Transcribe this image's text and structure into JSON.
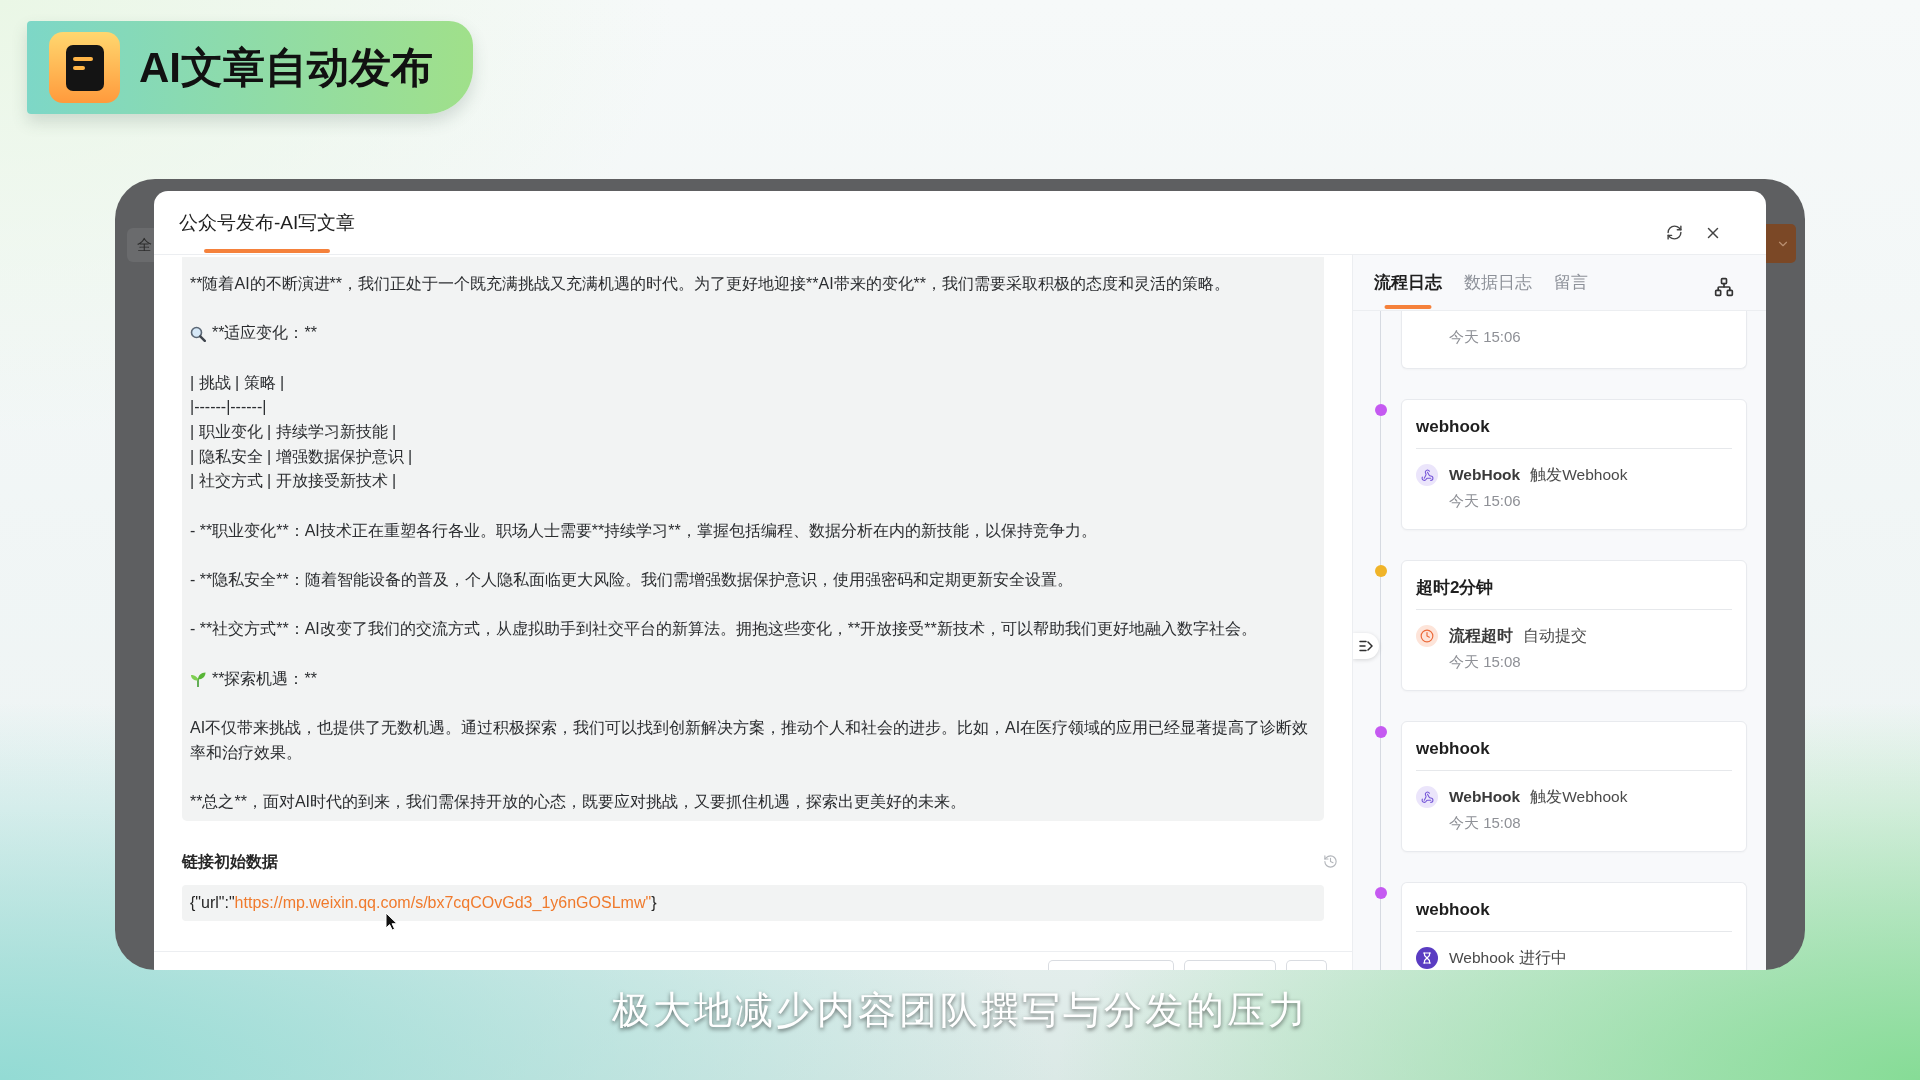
{
  "badge": {
    "title": "AI文章自动发布"
  },
  "backdrop": {
    "select_text": "全"
  },
  "modal": {
    "title": "公众号发布-AI写文章",
    "article": [
      {
        "kind": "text",
        "lines": [
          "**随着AI的不断演进**，我们正处于一个既充满挑战又充满机遇的时代。为了更好地迎接**AI带来的变化**，我们需要采取积极的态度和灵活的策略。"
        ]
      },
      {
        "kind": "search",
        "lines": [
          "**适应变化：**"
        ]
      },
      {
        "kind": "text",
        "lines": [
          "| 挑战 | 策略 |",
          "|------|------|",
          "| 职业变化 | 持续学习新技能 |",
          "| 隐私安全 | 增强数据保护意识 |",
          "| 社交方式 | 开放接受新技术 |"
        ]
      },
      {
        "kind": "text",
        "lines": [
          "- **职业变化**：AI技术正在重塑各行各业。职场人士需要**持续学习**，掌握包括编程、数据分析在内的新技能，以保持竞争力。"
        ]
      },
      {
        "kind": "text",
        "lines": [
          "- **隐私安全**：随着智能设备的普及，个人隐私面临更大风险。我们需增强数据保护意识，使用强密码和定期更新安全设置。"
        ]
      },
      {
        "kind": "text",
        "lines": [
          "- **社交方式**：AI改变了我们的交流方式，从虚拟助手到社交平台的新算法。拥抱这些变化，**开放接受**新技术，可以帮助我们更好地融入数字社会。"
        ]
      },
      {
        "kind": "sprout",
        "lines": [
          "**探索机遇：**"
        ]
      },
      {
        "kind": "text",
        "lines": [
          "AI不仅带来挑战，也提供了无数机遇。通过积极探索，我们可以找到创新解决方案，推动个人和社会的进步。比如，AI在医疗领域的应用已经显著提高了诊断效率和治疗效果。"
        ]
      },
      {
        "kind": "text",
        "lines": [
          "**总之**，面对AI时代的到来，我们需保持开放的心态，既要应对挑战，又要抓住机遇，探索出更美好的未来。"
        ]
      }
    ],
    "link_data": {
      "label": "链接初始数据",
      "prefix": "{\"url\":\"",
      "url": "https://mp.weixin.qq.com/s/bx7cqCOvGd3_1y6nGOSLmw\"",
      "suffix": "}"
    }
  },
  "side_panel": {
    "tabs": [
      {
        "label": "流程日志",
        "selected": true
      },
      {
        "label": "数据日志",
        "selected": false
      },
      {
        "label": "留言",
        "selected": false
      }
    ],
    "timeline": [
      {
        "time": "今天 15:06"
      },
      {
        "kind": "webhook",
        "color": "#c55af1",
        "title": "webhook",
        "actor": "WebHook",
        "action": "触发Webhook",
        "time": "今天 15:06"
      },
      {
        "kind": "timeout",
        "color": "#f0b429",
        "title": "超时2分钟",
        "actor": "流程超时",
        "action": "自动提交",
        "time": "今天 15:08"
      },
      {
        "kind": "webhook",
        "color": "#c55af1",
        "title": "webhook",
        "actor": "WebHook",
        "action": "触发Webhook",
        "time": "今天 15:08"
      },
      {
        "kind": "pending",
        "color": "#c55af1",
        "title": "webhook",
        "status": "Webhook 进行中"
      }
    ]
  },
  "caption": "极大地减少内容团队撰写与分发的压力"
}
